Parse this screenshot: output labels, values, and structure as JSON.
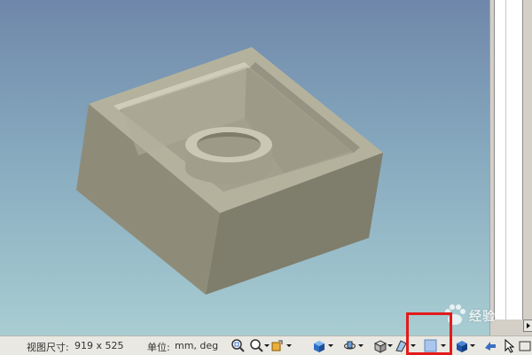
{
  "statusbar": {
    "view_size_label": "视图尺寸:",
    "view_size_value": "919 x 525",
    "units_label": "单位:",
    "units_value": "mm, deg"
  },
  "toolbar": {
    "icons": [
      "zoom-window-icon",
      "zoom-icon",
      "view-orient-icon",
      "shaded-box-icon",
      "rotate-view-icon",
      "edge-display-icon",
      "display-style-icon",
      "section-view-icon",
      "pan-icon",
      "select-arrow-icon",
      "frame-icon"
    ]
  },
  "watermark": {
    "text": "经验"
  },
  "colors": {
    "part_top": "#b9b9a4",
    "part_front": "#848270",
    "part_side": "#9e9c88",
    "highlight": "#e21b1b"
  }
}
